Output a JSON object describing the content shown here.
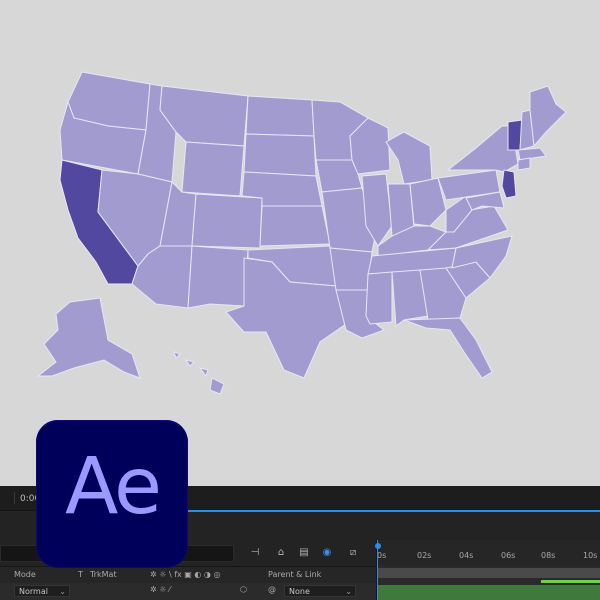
{
  "map": {
    "highlight_color": "#5248a0",
    "base_color": "#a29bd0",
    "highlighted_states": [
      "California",
      "Vermont",
      "New Jersey"
    ]
  },
  "panel": {
    "timecode": "0:00",
    "time_ruler": [
      "0s",
      "02s",
      "04s",
      "06s",
      "08s",
      "10s"
    ],
    "headers": {
      "mode": "Mode",
      "t": "T",
      "trkmat": "TrkMat",
      "parent_link": "Parent & Link"
    },
    "layer": {
      "mode_value": "Normal",
      "parent_value": "None"
    },
    "accent": "#2d8ceb"
  },
  "logo": {
    "text": "Ae",
    "bg_color": "#00005b",
    "fg_color": "#9999ff"
  }
}
